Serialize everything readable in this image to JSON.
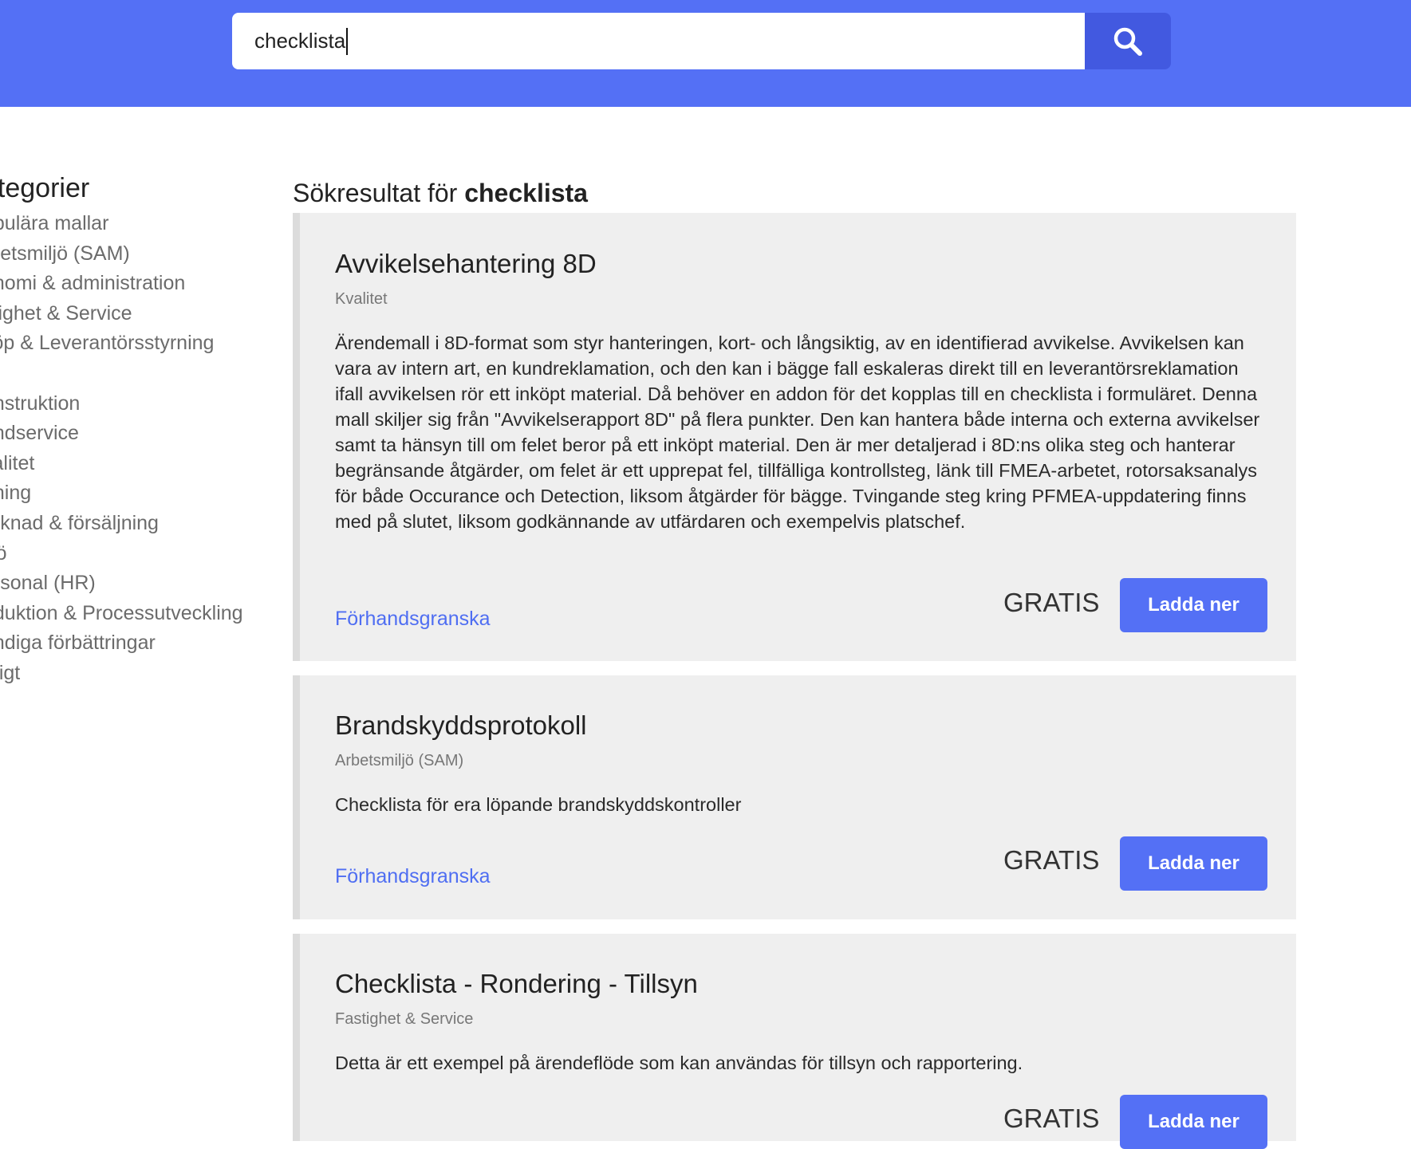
{
  "search": {
    "value": "checklista",
    "button_icon": "search-icon"
  },
  "sidebar": {
    "title": "ategorier",
    "items": [
      {
        "label": "opulära mallar"
      },
      {
        "label": "rbetsmiljö (SAM)"
      },
      {
        "label": "onomi & administration"
      },
      {
        "label": "stighet & Service"
      },
      {
        "label": "köp & Leverantörsstyrning"
      },
      {
        "label": ""
      },
      {
        "label": "onstruktion"
      },
      {
        "label": "undservice"
      },
      {
        "label": "valitet"
      },
      {
        "label": "dning"
      },
      {
        "label": "arknad & försäljning"
      },
      {
        "label": "iljö"
      },
      {
        "label": "ersonal (HR)"
      },
      {
        "label": "oduktion & Processutveckling"
      },
      {
        "label": "ändiga förbättringar"
      },
      {
        "label": "vrigt"
      }
    ]
  },
  "results": {
    "heading_prefix": "Sökresultat för ",
    "heading_query": "checklista",
    "items": [
      {
        "title": "Avvikelsehantering 8D",
        "category": "Kvalitet",
        "description": "Ärendemall i 8D-format som styr hanteringen, kort- och långsiktig, av en identifierad avvikelse. Avvikelsen kan vara av intern art, en kundreklamation, och den kan i bägge fall eskaleras direkt till en leverantörsreklamation ifall avvikelsen rör ett inköpt material. Då behöver en addon för det kopplas till en checklista i formuläret. Denna mall skiljer sig från \"Avvikelserapport 8D\" på flera punkter. Den kan hantera både interna och externa avvikelser samt ta hänsyn till om felet beror på ett inköpt material. Den är mer detaljerad i 8D:ns olika steg och hanterar begränsande åtgärder, om felet är ett upprepat fel, tillfälliga kontrollsteg, länk till FMEA-arbetet, rotorsaksanalys för både Occurance och Detection, liksom åtgärder för bägge. Tvingande steg kring PFMEA-uppdatering finns med på slutet, liksom godkännande av utfärdaren och exempelvis platschef.",
        "preview_label": "Förhandsgranska",
        "price": "GRATIS",
        "download_label": "Ladda ner"
      },
      {
        "title": "Brandskyddsprotokoll",
        "category": "Arbetsmiljö (SAM)",
        "description": "Checklista för era löpande brandskyddskontroller",
        "preview_label": "Förhandsgranska",
        "price": "GRATIS",
        "download_label": "Ladda ner"
      },
      {
        "title": "Checklista - Rondering - Tillsyn",
        "category": "Fastighet & Service",
        "description": "Detta är ett exempel på ärendeflöde som kan användas för tillsyn och rapportering.",
        "preview_label": "Förhandsgranska",
        "price": "GRATIS",
        "download_label": "Ladda ner"
      }
    ]
  },
  "colors": {
    "header": "#5470f5",
    "search_button": "#4259e0",
    "accent": "#5470f5",
    "card_bg": "#efefef",
    "link": "#4f6ef2"
  }
}
